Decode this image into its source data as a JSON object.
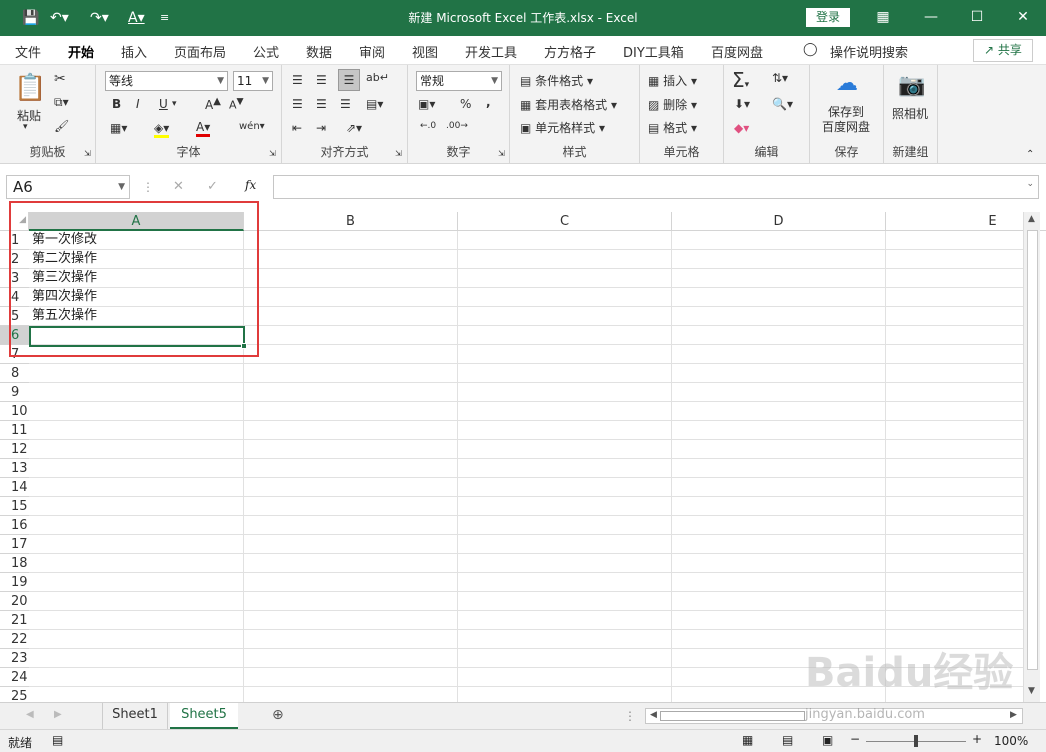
{
  "window": {
    "title": "新建 Microsoft Excel 工作表.xlsx  -  Excel",
    "login": "登录"
  },
  "ribbon_tabs": [
    "文件",
    "开始",
    "插入",
    "页面布局",
    "公式",
    "数据",
    "审阅",
    "视图",
    "开发工具",
    "方方格子",
    "DIY工具箱",
    "百度网盘",
    "操作说明搜索"
  ],
  "share": "共享",
  "groups": {
    "clipboard": {
      "label": "剪贴板",
      "paste": "粘贴"
    },
    "font": {
      "label": "字体",
      "font_name": "等线",
      "font_size": "11",
      "bold": "B",
      "italic": "I",
      "underline": "U"
    },
    "align": {
      "label": "对齐方式"
    },
    "number": {
      "label": "数字",
      "format": "常规"
    },
    "styles": {
      "label": "样式",
      "cond": "条件格式",
      "table": "套用表格格式",
      "cell": "单元格样式"
    },
    "cells": {
      "label": "单元格",
      "insert": "插入",
      "delete": "删除",
      "format": "格式"
    },
    "edit": {
      "label": "编辑"
    },
    "save": {
      "label": "保存",
      "btn": "保存到\n百度网盘"
    },
    "newgrp": {
      "label": "新建组",
      "btn": "照相机"
    }
  },
  "namebox": "A6",
  "fx": "fx",
  "columns": [
    "A",
    "B",
    "C",
    "D",
    "E"
  ],
  "rows": [
    "1",
    "2",
    "3",
    "4",
    "5",
    "6",
    "7",
    "8",
    "9",
    "10",
    "11",
    "12",
    "13",
    "14",
    "15",
    "16",
    "17",
    "18",
    "19",
    "20",
    "21",
    "22",
    "23",
    "24",
    "25"
  ],
  "cells": {
    "A1": "第一次修改",
    "A2": "第二次操作",
    "A3": "第三次操作",
    "A4": "第四次操作",
    "A5": "第五次操作"
  },
  "sheets": [
    "Sheet1",
    "Sheet5"
  ],
  "status": {
    "ready": "就绪",
    "zoom": "100%"
  },
  "watermark": {
    "logo": "Baidu经验",
    "url": "jingyan.baidu.com"
  }
}
